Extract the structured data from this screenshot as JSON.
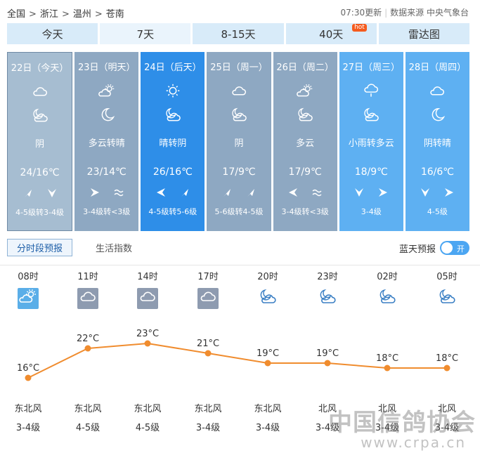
{
  "breadcrumb": [
    "全国",
    "浙江",
    "温州",
    "苍南"
  ],
  "breadcrumb_sep": ">",
  "update_time": "07:30更新",
  "source": "数据来源 中央气象台",
  "tabs": [
    {
      "label": "今天",
      "active": false
    },
    {
      "label": "7天",
      "active": true
    },
    {
      "label": "8-15天",
      "active": false
    },
    {
      "label": "40天",
      "active": false,
      "badge": "hot"
    },
    {
      "label": "雷达图",
      "active": false
    }
  ],
  "days": [
    {
      "head": "22日（今天）",
      "icon_day": "cloud-icon",
      "icon_night": "moon-cloud-icon",
      "desc": "阴",
      "temp": "24/16℃",
      "wind_dir": [
        "arrow-ne",
        "arrow-down"
      ],
      "wind": "4-5级转3-4级",
      "style": "selected"
    },
    {
      "head": "23日（明天）",
      "icon_day": "sun-cloud-icon",
      "icon_night": "moon-icon",
      "desc": "多云转晴",
      "temp": "23/14℃",
      "wind_dir": [
        "arrow-right",
        "wave"
      ],
      "wind": "3-4级转<3级",
      "style": "gray"
    },
    {
      "head": "24日（后天）",
      "icon_day": "sun-icon",
      "icon_night": "moon-cloud-icon",
      "desc": "晴转阴",
      "temp": "26/16℃",
      "wind_dir": [
        "arrow-left",
        "arrow-ne"
      ],
      "wind": "4-5级转5-6级",
      "style": "blue"
    },
    {
      "head": "25日（周一）",
      "icon_day": "cloud-icon",
      "icon_night": "moon-cloud-icon",
      "desc": "阴",
      "temp": "17/9℃",
      "wind_dir": [
        "arrow-ne",
        "arrow-ne"
      ],
      "wind": "5-6级转4-5级",
      "style": "gray"
    },
    {
      "head": "26日（周二）",
      "icon_day": "sun-cloud-icon",
      "icon_night": "moon-cloud-icon",
      "desc": "多云",
      "temp": "17/9℃",
      "wind_dir": [
        "arrow-left",
        "wave"
      ],
      "wind": "3-4级转<3级",
      "style": "gray"
    },
    {
      "head": "27日（周三）",
      "icon_day": "rain-icon",
      "icon_night": "moon-cloud-icon",
      "desc": "小雨转多云",
      "temp": "18/9℃",
      "wind_dir": [
        "arrow-down",
        "arrow-right"
      ],
      "wind": "3-4级",
      "style": "sky"
    },
    {
      "head": "28日（周四）",
      "icon_day": "cloud-icon",
      "icon_night": "moon-icon",
      "desc": "阴转晴",
      "temp": "16/6℃",
      "wind_dir": [
        "arrow-down",
        "arrow-right"
      ],
      "wind": "4-5级",
      "style": "sky"
    }
  ],
  "subtabs": {
    "active": "分时段预报",
    "other": "生活指数"
  },
  "radar_forecast": {
    "label": "蓝天预报",
    "toggle": "开"
  },
  "hourly": [
    {
      "time": "08时",
      "icon": "sun-cloud-icon",
      "boxed": true,
      "box_color": "#5aaee8",
      "temp": 16,
      "temp_label": "16°C",
      "wind_dir": "东北风",
      "wind_level": "3-4级"
    },
    {
      "time": "11时",
      "icon": "cloud-icon",
      "boxed": true,
      "box_color": "#8e9bb0",
      "temp": 22,
      "temp_label": "22°C",
      "wind_dir": "东北风",
      "wind_level": "4-5级"
    },
    {
      "time": "14时",
      "icon": "cloud-icon",
      "boxed": true,
      "box_color": "#8e9bb0",
      "temp": 23,
      "temp_label": "23°C",
      "wind_dir": "东北风",
      "wind_level": "4-5级"
    },
    {
      "time": "17时",
      "icon": "cloud-icon",
      "boxed": true,
      "box_color": "#8e9bb0",
      "temp": 21,
      "temp_label": "21°C",
      "wind_dir": "东北风",
      "wind_level": "3-4级"
    },
    {
      "time": "20时",
      "icon": "moon-cloud-icon",
      "boxed": false,
      "temp": 19,
      "temp_label": "19°C",
      "wind_dir": "东北风",
      "wind_level": "3-4级"
    },
    {
      "time": "23时",
      "icon": "moon-cloud-icon",
      "boxed": false,
      "temp": 19,
      "temp_label": "19°C",
      "wind_dir": "北风",
      "wind_level": "3-4级"
    },
    {
      "time": "02时",
      "icon": "moon-cloud-icon",
      "boxed": false,
      "temp": 18,
      "temp_label": "18°C",
      "wind_dir": "北风",
      "wind_level": "3-4级"
    },
    {
      "time": "05时",
      "icon": "moon-cloud-icon",
      "boxed": false,
      "temp": 18,
      "temp_label": "18°C",
      "wind_dir": "北风",
      "wind_level": "3-4级"
    }
  ],
  "colors": {
    "line": "#f08c2e",
    "point": "#f08c2e"
  },
  "watermark": {
    "main": "中国信鸽协会",
    "url": "www.crpa.cn"
  }
}
